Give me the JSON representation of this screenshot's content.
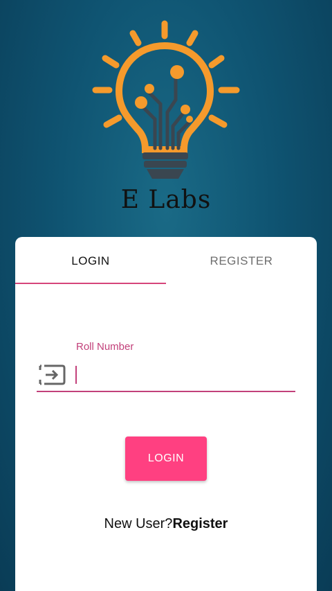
{
  "brand": {
    "name": "E Labs",
    "colors": {
      "bulb": "#f59a2c",
      "base": "#3a4650",
      "background": "#0f5472"
    }
  },
  "tabs": [
    {
      "label": "LOGIN",
      "active": true
    },
    {
      "label": "REGISTER",
      "active": false
    }
  ],
  "form": {
    "roll_label": "Roll Number",
    "roll_value": "",
    "login_button": "LOGIN"
  },
  "footer": {
    "prompt": "New User?",
    "link": "Register"
  },
  "colors": {
    "accent": "#ff4081",
    "field_accent": "#c2407a"
  }
}
